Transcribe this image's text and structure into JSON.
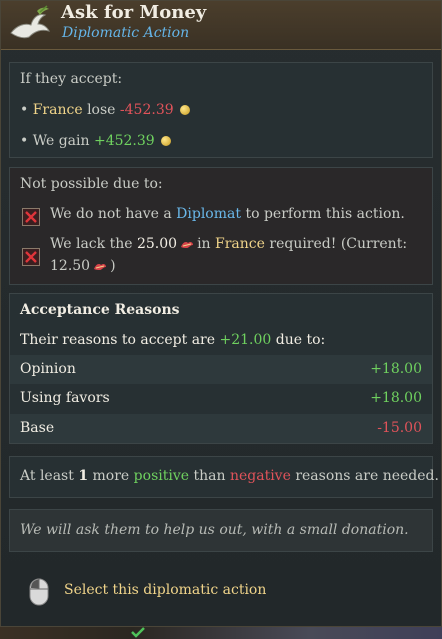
{
  "header": {
    "title": "Ask for Money",
    "subtitle": "Diplomatic Action",
    "icon": "dove-icon"
  },
  "accept": {
    "heading": "If they accept:",
    "line1": {
      "bullet": "•",
      "country": "France",
      "verb": "lose",
      "amount": "-452.39",
      "icon": "gold-coin-icon"
    },
    "line2": {
      "bullet": "•",
      "prefix": "We gain",
      "amount": "+452.39",
      "icon": "gold-coin-icon"
    }
  },
  "not_possible": {
    "heading": "Not possible due to:",
    "reason1": {
      "pre": "We do not have a",
      "link": "Diplomat",
      "post": "to perform this action."
    },
    "reason2": {
      "pre": "We lack the",
      "amount": "25.00",
      "mid": "in",
      "country": "France",
      "post": "required! (Current:",
      "current": "12.50",
      "close": ")",
      "icon": "favors-icon"
    }
  },
  "reasons": {
    "heading": "Acceptance Reasons",
    "intro_pre": "Their reasons to accept are",
    "intro_value": "+21.00",
    "intro_post": "due to:",
    "rows": [
      {
        "label": "Opinion",
        "value": "+18.00"
      },
      {
        "label": "Using favors",
        "value": "+18.00"
      },
      {
        "label": "Base",
        "value": "-15.00"
      }
    ]
  },
  "at_least": {
    "pre": "At least",
    "count": "1",
    "mid1": "more",
    "positive": "positive",
    "mid2": "than",
    "negative": "negative",
    "post": "reasons are needed."
  },
  "flavor": "We will ask them to help us out, with a small donation.",
  "action": {
    "label": "Select this diplomatic action",
    "icon": "mouse-left-click-icon"
  },
  "colors": {
    "highlight": "#f0d48a",
    "negative": "#e0535a",
    "positive": "#6fd15f",
    "link": "#6ab8ea",
    "subtitle": "#65b5e8"
  }
}
